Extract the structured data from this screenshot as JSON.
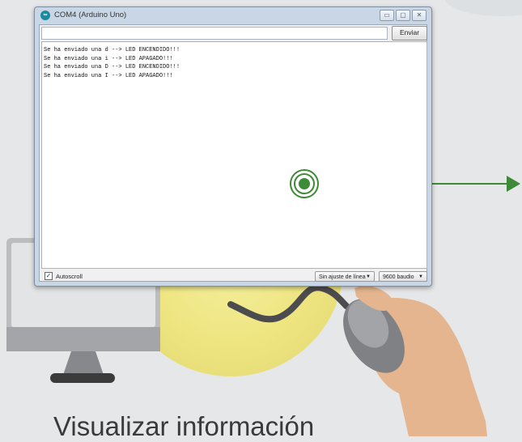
{
  "window": {
    "title": "COM4 (Arduino Uno)",
    "icon": "arduino-logo-icon",
    "controls": [
      "minimize-icon",
      "maximize-icon",
      "close-icon"
    ],
    "minimize_glyph": "▭",
    "maximize_glyph": "▢",
    "close_glyph": "✕"
  },
  "input": {
    "value": "",
    "placeholder": ""
  },
  "send_button": {
    "label": "Enviar"
  },
  "console": {
    "lines": [
      "Se ha enviado una d --> LED ENCENDIDO!!!",
      "Se ha enviado una i --> LED APAGADO!!!",
      "Se ha enviado una D --> LED ENCENDIDO!!!",
      "Se ha enviado una I --> LED APAGADO!!!"
    ]
  },
  "footer": {
    "autoscroll_label": "Autoscroll",
    "autoscroll_checked": true,
    "check_glyph": "✓",
    "line_ending": "Sin ajuste de línea",
    "baud_rate": "9600 baudio",
    "dropdown_glyph": "▼"
  },
  "caption": "Visualizar información",
  "colors": {
    "background": "#e6e7e8",
    "yellow_glow": "#f0ea9a",
    "accent_green": "#3d8b37",
    "hand": "#e3b48d",
    "monitor": "#c6c8ca"
  }
}
